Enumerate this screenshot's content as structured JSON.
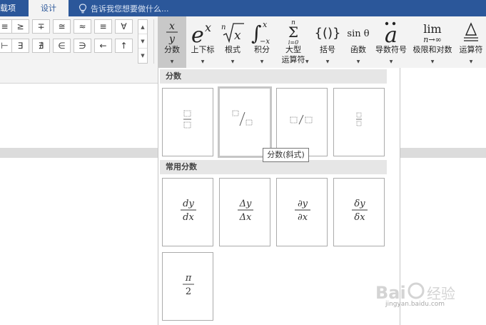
{
  "tabs": {
    "prev": "载项",
    "active": "设计",
    "tell_me": "告诉我您想要做什么..."
  },
  "symbols": {
    "row1": [
      "≡",
      "≥",
      "∓",
      "≅",
      "≈",
      "≡",
      "∀"
    ],
    "row2": [
      "⊢",
      "∃",
      "∄",
      "∈",
      "∋",
      "←",
      "↑"
    ]
  },
  "ribbon": {
    "fraction": "分数",
    "script": "上下标",
    "radical": "根式",
    "integral": "积分",
    "large_operator_1": "大型",
    "large_operator_2": "运算符",
    "bracket": "括号",
    "function": "函数",
    "accent": "导数符号",
    "limit_log": "极限和对数",
    "operator": "运算符"
  },
  "gallery": {
    "section_fraction": "分数",
    "section_common": "常用分数",
    "common": [
      {
        "num": "dy",
        "den": "dx"
      },
      {
        "num": "Δy",
        "den": "Δx"
      },
      {
        "num": "∂y",
        "den": "∂x"
      },
      {
        "num": "δy",
        "den": "δx"
      },
      {
        "num": "π",
        "den": "2"
      }
    ]
  },
  "tooltip": "分数(斜式)",
  "watermark": {
    "cn": "经验",
    "url": "jingyan.baidu.com"
  }
}
